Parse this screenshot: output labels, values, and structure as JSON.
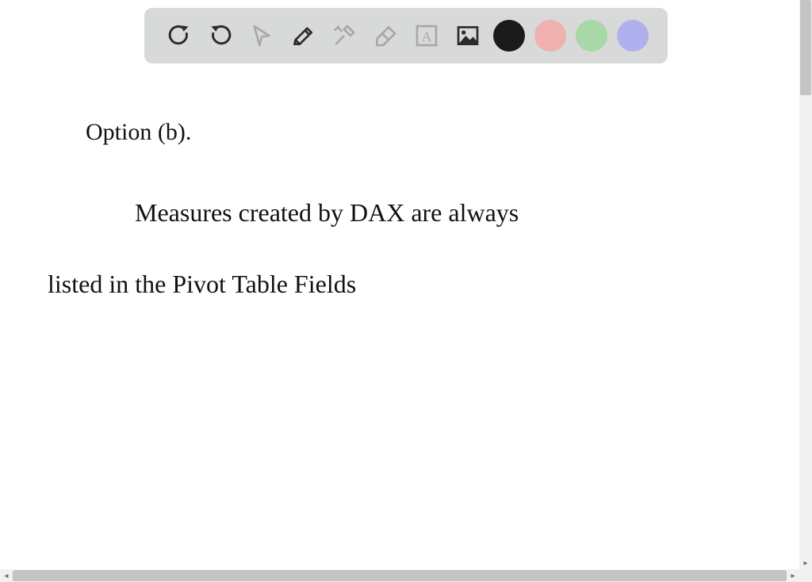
{
  "toolbar": {
    "tools": {
      "undo": "undo",
      "redo": "redo",
      "select": "select",
      "pencil": "pencil",
      "tools": "tools",
      "eraser": "eraser",
      "text": "text",
      "image": "image"
    },
    "colors": {
      "black": "#1a1a1a",
      "pink": "#f0b0b0",
      "green": "#a8d8a8",
      "purple": "#b0b0ef"
    }
  },
  "handwriting": {
    "line1": "Option (b).",
    "line2": "Measures created by DAX are always",
    "line3": "listed in the Pivot Table Fields"
  }
}
